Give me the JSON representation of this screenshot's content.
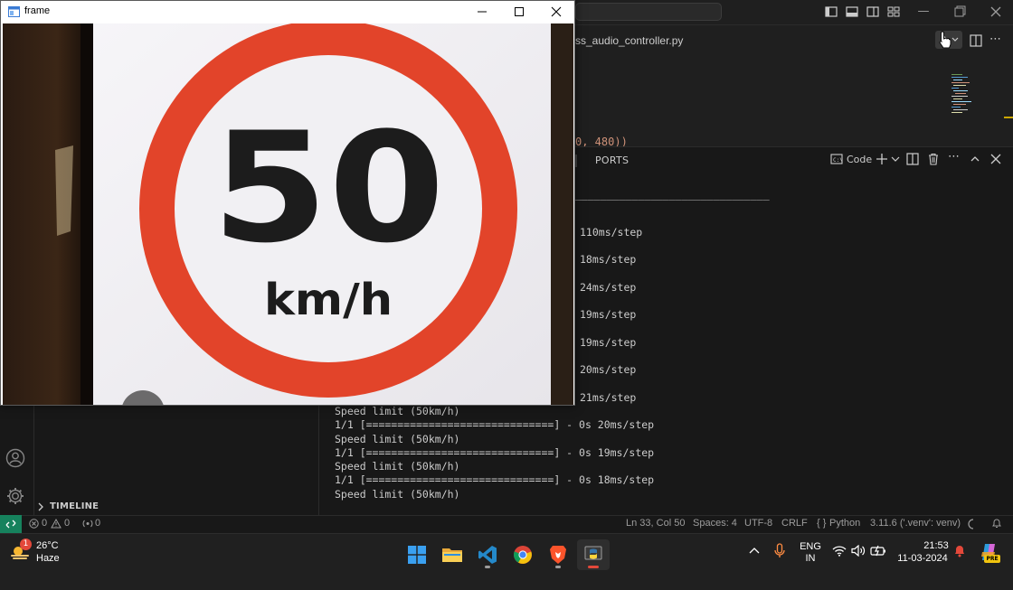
{
  "frame_window": {
    "title": "frame",
    "sign": {
      "number": "50",
      "unit": "km/h"
    },
    "colors": {
      "ring": "#e2442a",
      "face": "#f1f0f3",
      "digits": "#1c1c1c",
      "background": "#2a1b12"
    }
  },
  "vscode": {
    "editor": {
      "tab_label": "ss_audio_controller.py",
      "code_fragment": "0, 480))"
    },
    "panel": {
      "tab_ports": "PORTS",
      "terminal_profile": "Code",
      "dash_line": "_______________________________",
      "partial_lines": [
        "110ms/step",
        "18ms/step",
        "24ms/step",
        "19ms/step",
        "19ms/step",
        "20ms/step",
        "21ms/step"
      ],
      "full_lines": [
        "Speed limit (50km/h)",
        "1/1 [==============================] - 0s 20ms/step",
        "Speed limit (50km/h)",
        "1/1 [==============================] - 0s 19ms/step",
        "Speed limit (50km/h)",
        "1/1 [==============================] - 0s 18ms/step",
        "Speed limit (50km/h)"
      ]
    },
    "sidebar": {
      "timeline_label": "TIMELINE"
    },
    "statusbar": {
      "errors": "0",
      "warnings": "0",
      "ports": "0",
      "position": "Ln 33, Col 50",
      "spaces": "Spaces: 4",
      "encoding": "UTF-8",
      "eol": "CRLF",
      "language": "Python",
      "interpreter": "3.11.6 ('.venv': venv)"
    },
    "accent": "#16825d"
  },
  "taskbar": {
    "weather": {
      "temp": "26°C",
      "condition": "Haze",
      "badge": "1"
    },
    "language": {
      "line1": "ENG",
      "line2": "IN"
    },
    "clock": {
      "time": "21:53",
      "date": "11-03-2024"
    },
    "copilot_badge": "PRE",
    "apps": [
      "windows-start-icon",
      "file-explorer-icon",
      "vscode-icon",
      "chrome-icon",
      "brave-icon",
      "python-icon"
    ]
  }
}
